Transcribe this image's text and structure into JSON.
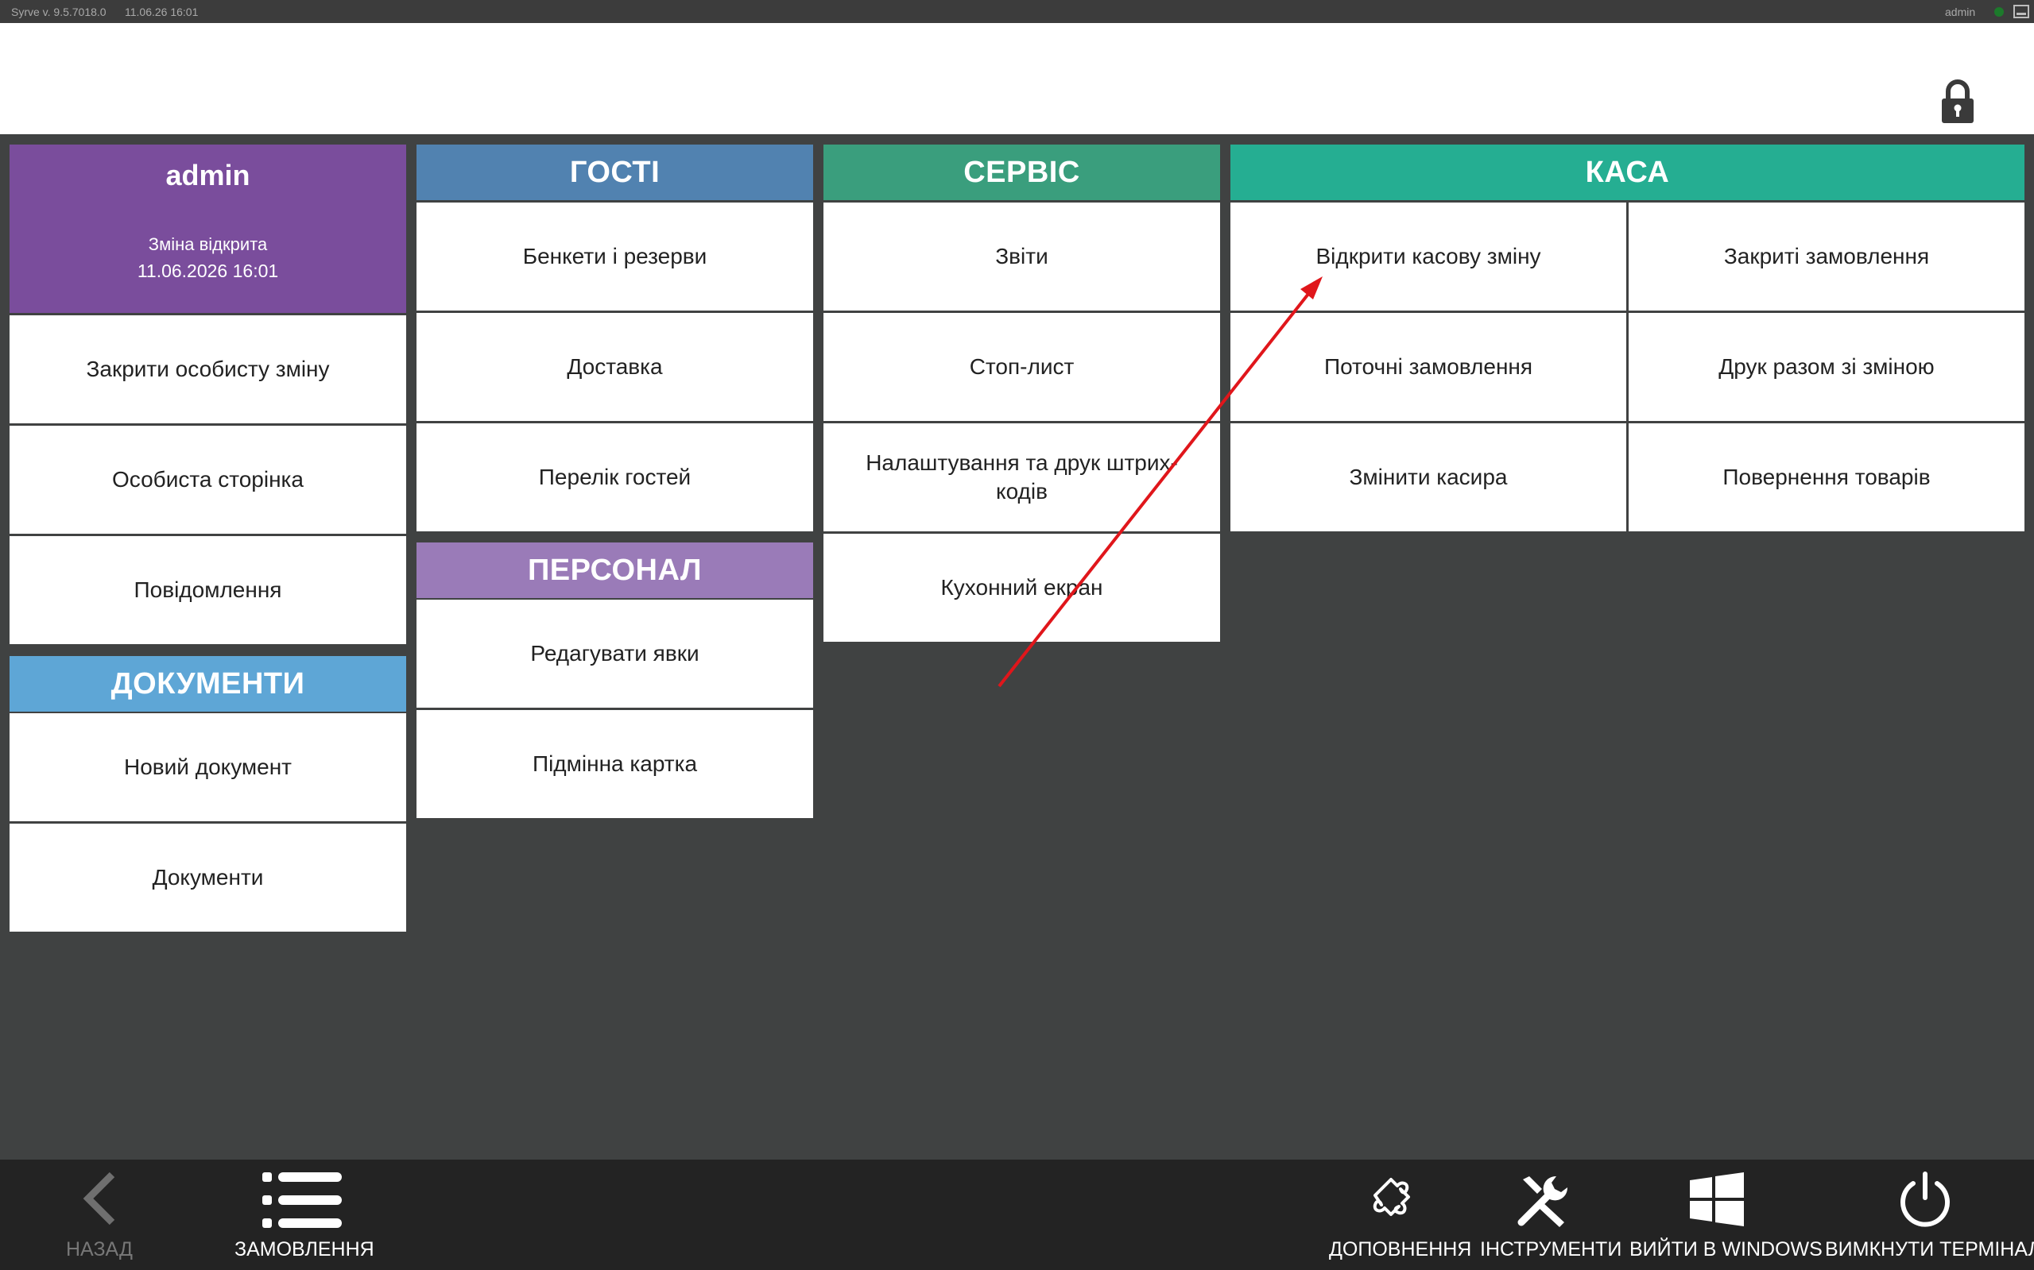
{
  "titlebar": {
    "version": "Syrve  v. 9.5.7018.0",
    "datetime": "11.06.26   16:01",
    "user": "admin"
  },
  "user_panel": {
    "name": "admin",
    "shift_status": "Зміна відкрита",
    "shift_datetime": "11.06.2026 16:01",
    "items": [
      "Закрити особисту зміну",
      "Особиста сторінка",
      "Повідомлення"
    ]
  },
  "documents": {
    "title": "ДОКУМЕНТИ",
    "items": [
      "Новий документ",
      "Документи"
    ]
  },
  "guests": {
    "title": "ГОСТІ",
    "items": [
      "Бенкети і резерви",
      "Доставка",
      "Перелік гостей"
    ]
  },
  "staff": {
    "title": "ПЕРСОНАЛ",
    "items": [
      "Редагувати явки",
      "Підмінна картка"
    ]
  },
  "service": {
    "title": "СЕРВІС",
    "items": [
      "Звіти",
      "Стоп-лист",
      "Налаштування та друк штрих-кодів",
      "Кухонний екран"
    ]
  },
  "cash": {
    "title": "КАСА",
    "items": [
      "Відкрити касову зміну",
      "Закриті замовлення",
      "Поточні замовлення",
      "Друк разом зі зміною",
      "Змінити касира",
      "Повернення товарів"
    ]
  },
  "bottombar": {
    "back": "НАЗАД",
    "orders": "ЗАМОВЛЕННЯ",
    "addons": "ДОПОВНЕННЯ",
    "tools": "ІНСТРУМЕНТИ",
    "exit_windows": "ВИЙТИ В WINDOWS",
    "shutdown": "ВИМКНУТИ ТЕРМІНАЛ"
  },
  "colors": {
    "user": "#7a4d9c",
    "documents": "#5ea6d6",
    "guests": "#5182b0",
    "staff": "#9a7bb8",
    "service": "#3a9e7d",
    "cash": "#25ae92",
    "background": "#404242",
    "bottombar": "#232323",
    "annotation_arrow": "#e0161b"
  },
  "icons": {
    "lock": "lock-icon",
    "back": "chevron-left-icon",
    "orders": "list-icon",
    "addons": "puzzle-icon",
    "tools": "tools-icon",
    "exit_windows": "windows-icon",
    "shutdown": "power-icon"
  }
}
